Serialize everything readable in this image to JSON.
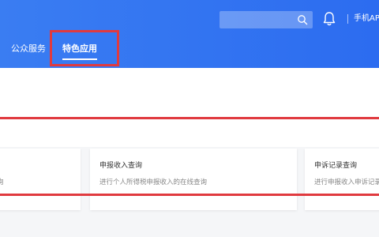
{
  "header": {
    "search": {
      "placeholder": ""
    },
    "app_link_label": "手机APP"
  },
  "nav": {
    "tabs": [
      {
        "label": "公众服务",
        "active": false
      },
      {
        "label": "特色应用",
        "active": true
      }
    ]
  },
  "cards": [
    {
      "title": "",
      "desc": "询"
    },
    {
      "title": "申报收入查询",
      "desc": "进行个人所得税申报收入的在线查询"
    },
    {
      "title": "申诉记录查询",
      "desc": "进行申报收入申诉记录"
    }
  ],
  "colors": {
    "header_blue": "#2c6cf0",
    "highlight_red": "#e03a3f",
    "page_bg": "#f5f6f8"
  }
}
